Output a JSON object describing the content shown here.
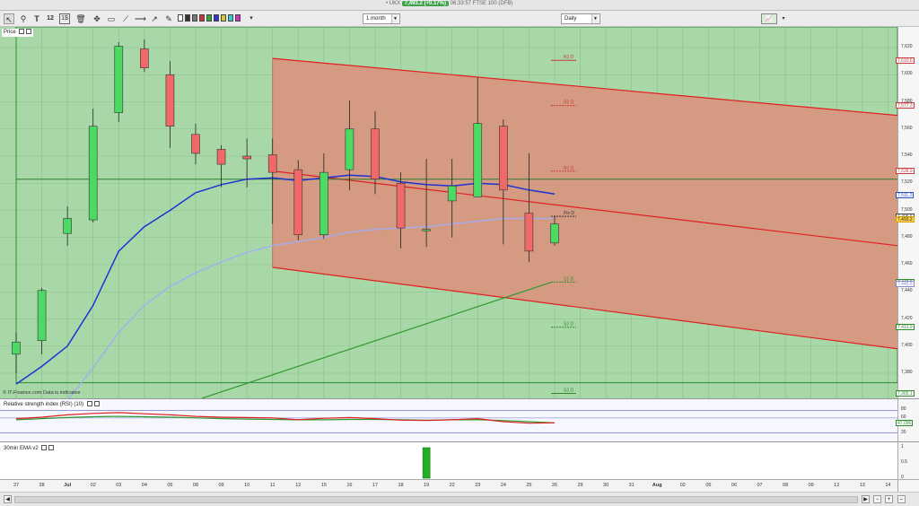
{
  "title_bar": {
    "prefix": "• UKX",
    "price_badge": "7,493.2 (+0.17%)",
    "suffix": "06:33:57 FTSE 100 (DFB)"
  },
  "toolbar": {
    "period_select": "1 month",
    "interval_select": "Daily",
    "icons": [
      "pointer-icon",
      "zoom-icon",
      "text-icon",
      "number-icon",
      "delete-icon",
      "move-icon",
      "rectangle-icon",
      "line-icon",
      "brush-icon",
      "swatch-icon",
      "chart-type-icon"
    ]
  },
  "price_pane": {
    "label": "Price",
    "copyright": "© IT-Finance.com  Data is indicative",
    "y_ticks": [
      "7,620",
      "7,600",
      "7,580",
      "7,560",
      "7,540",
      "7,520",
      "7,500",
      "7,480",
      "7,460",
      "7,440",
      "7,420",
      "7,400",
      "7,380"
    ],
    "tags": [
      {
        "text": "7,610.6",
        "color": "#c83c3c"
      },
      {
        "text": "7,577.3",
        "color": "#c83c3c"
      },
      {
        "text": "7,528.9",
        "color": "#c83c3c"
      },
      {
        "text": "7,511.2",
        "color": "#3050c8"
      },
      {
        "text": "7,495.6",
        "color": "#444444"
      },
      {
        "text": "7,493.2",
        "color": "#e0a000"
      },
      {
        "text": "7,447.2",
        "color": "#2e8b2e"
      },
      {
        "text": "7,445.6",
        "color": "#8a8acb"
      },
      {
        "text": "7,413.9",
        "color": "#2e8b2e"
      },
      {
        "text": "7,365.1",
        "color": "#2e8b2e"
      }
    ],
    "pivots": [
      {
        "name": "R3 D",
        "value": 7610.6,
        "color": "#c83c3c"
      },
      {
        "name": "R2 D",
        "value": 7577.3,
        "color": "#c83c3c"
      },
      {
        "name": "R1 D",
        "value": 7528.9,
        "color": "#c83c3c"
      },
      {
        "name": "Piv D",
        "value": 7495.6,
        "color": "#333333"
      },
      {
        "name": "S1 D",
        "value": 7447.2,
        "color": "#2e8b2e"
      },
      {
        "name": "S2 D",
        "value": 7413.9,
        "color": "#2e8b2e"
      },
      {
        "name": "S3 D",
        "value": 7365.1,
        "color": "#2e8b2e"
      }
    ],
    "colors": {
      "up": "#4cd964",
      "down": "#f06868",
      "green_zone": "#a8d8a8",
      "red_zone": "#d49a82"
    }
  },
  "rsi_pane": {
    "label": "Relative strength index (RSI) (10)",
    "y_ticks": [
      "80",
      "60",
      "20"
    ],
    "tags": [
      {
        "text": "47.096",
        "color": "#2e8b2e"
      }
    ]
  },
  "ema_pane": {
    "label": "30min EMA v2",
    "y_ticks": [
      "1",
      "0.5",
      "0"
    ]
  },
  "x_axis": {
    "labels": [
      "27",
      "28",
      "Jul",
      "02",
      "03",
      "04",
      "05",
      "08",
      "09",
      "10",
      "11",
      "12",
      "15",
      "16",
      "17",
      "18",
      "19",
      "22",
      "23",
      "24",
      "25",
      "26",
      "29",
      "30",
      "31",
      "Aug",
      "02",
      "05",
      "06",
      "07",
      "08",
      "09",
      "12",
      "13",
      "14"
    ]
  },
  "chart_data": {
    "type": "candlestick",
    "ylim": [
      7365,
      7630
    ],
    "candles": [
      {
        "x": "27",
        "open": 7394,
        "close": 7403,
        "high": 7410,
        "low": 7380
      },
      {
        "x": "28",
        "open": 7404,
        "close": 7441,
        "high": 7443,
        "low": 7394
      },
      {
        "x": "Jul",
        "open": 7483,
        "close": 7494,
        "high": 7503,
        "low": 7474
      },
      {
        "x": "02",
        "open": 7493,
        "close": 7562,
        "high": 7575,
        "low": 7491
      },
      {
        "x": "03",
        "open": 7572,
        "close": 7621,
        "high": 7624,
        "low": 7565
      },
      {
        "x": "04",
        "open": 7619,
        "close": 7605,
        "high": 7626,
        "low": 7602
      },
      {
        "x": "05",
        "open": 7600,
        "close": 7562,
        "high": 7610,
        "low": 7546
      },
      {
        "x": "08",
        "open": 7556,
        "close": 7542,
        "high": 7564,
        "low": 7534
      },
      {
        "x": "09",
        "open": 7545,
        "close": 7534,
        "high": 7548,
        "low": 7517
      },
      {
        "x": "10",
        "open": 7540,
        "close": 7538,
        "high": 7553,
        "low": 7517
      },
      {
        "x": "11",
        "open": 7541,
        "close": 7528,
        "high": 7553,
        "low": 7490
      },
      {
        "x": "12",
        "open": 7530,
        "close": 7482,
        "high": 7537,
        "low": 7478
      },
      {
        "x": "15",
        "open": 7482,
        "close": 7528,
        "high": 7542,
        "low": 7479
      },
      {
        "x": "16",
        "open": 7530,
        "close": 7560,
        "high": 7581,
        "low": 7515
      },
      {
        "x": "17",
        "open": 7560,
        "close": 7523,
        "high": 7573,
        "low": 7512
      },
      {
        "x": "18",
        "open": 7520,
        "close": 7487,
        "high": 7528,
        "low": 7472
      },
      {
        "x": "19",
        "open": 7485,
        "close": 7486,
        "high": 7538,
        "low": 7473
      },
      {
        "x": "22",
        "open": 7507,
        "close": 7518,
        "high": 7538,
        "low": 7480
      },
      {
        "x": "23",
        "open": 7510,
        "close": 7564,
        "high": 7598,
        "low": 7515
      },
      {
        "x": "24",
        "open": 7562,
        "close": 7515,
        "high": 7567,
        "low": 7475
      },
      {
        "x": "25",
        "open": 7498,
        "close": 7470,
        "high": 7542,
        "low": 7462
      },
      {
        "x": "26",
        "open": 7476,
        "close": 7490,
        "high": 7496,
        "low": 7474
      }
    ],
    "ema_fast": [
      7372,
      7385,
      7400,
      7430,
      7470,
      7488,
      7500,
      7513,
      7519,
      7523,
      7524,
      7522,
      7524,
      7526,
      7525,
      7521,
      7519,
      7518,
      7520,
      7519,
      7515,
      7512
    ],
    "ema_slow": [
      7330,
      7345,
      7360,
      7384,
      7410,
      7430,
      7444,
      7454,
      7462,
      7469,
      7474,
      7477,
      7480,
      7484,
      7486,
      7487,
      7488,
      7490,
      7492,
      7494,
      7494,
      7494
    ],
    "channel": {
      "start_x": "11",
      "end_x": "14",
      "top": [
        7612,
        7570
      ],
      "mid": [
        7529,
        7474
      ],
      "bottom": [
        7458,
        7398
      ]
    },
    "horizontal_line": 7523,
    "rsi": [
      58,
      62,
      68,
      72,
      74,
      71,
      68,
      64,
      62,
      61,
      60,
      55,
      59,
      61,
      58,
      54,
      53,
      55,
      58,
      50,
      46,
      47
    ],
    "rsi_ref": [
      55,
      58,
      61,
      63,
      64,
      63,
      62,
      60,
      58,
      57,
      56,
      55,
      55,
      56,
      56,
      55,
      54,
      55,
      55,
      53,
      50,
      47
    ],
    "ema_signal": {
      "x": "19",
      "value": 1
    }
  }
}
